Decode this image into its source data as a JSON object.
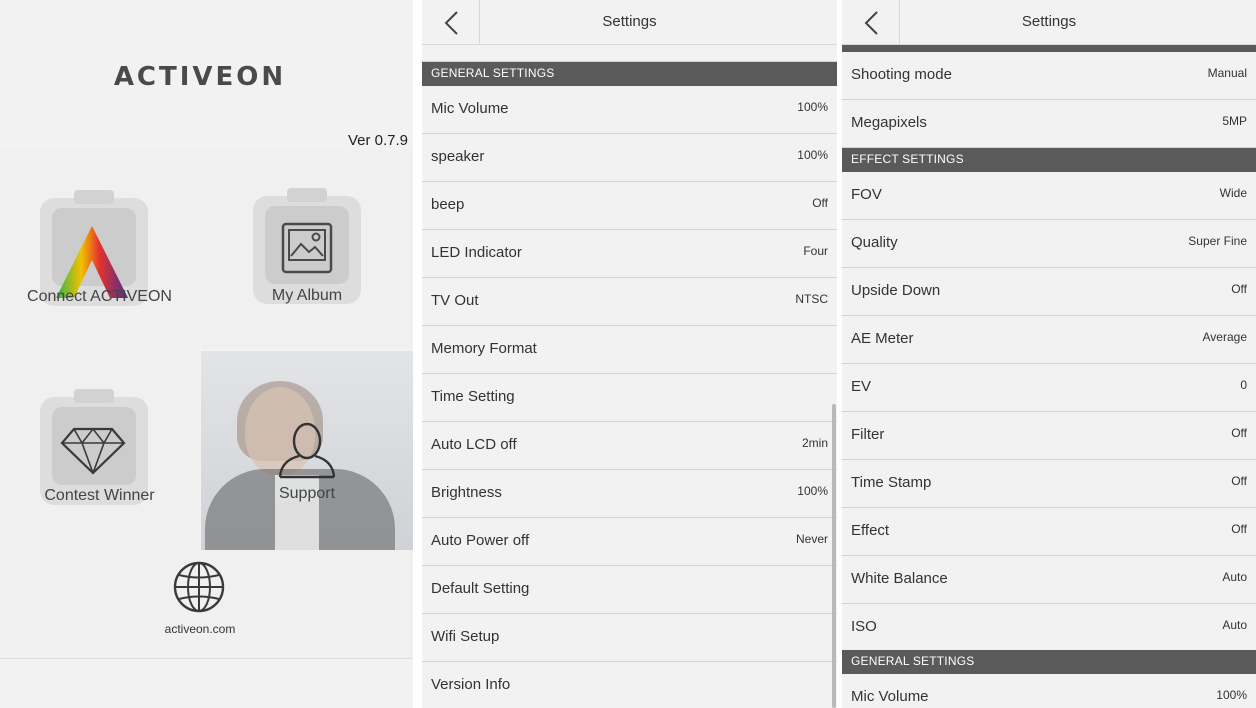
{
  "home": {
    "logo": "ACTIVEON",
    "version": "Ver 0.7.9",
    "tiles": {
      "connect": "Connect ACTIVEON",
      "album": "My Album",
      "contest": "Contest Winner",
      "support": "Support"
    },
    "website": "activeon.com"
  },
  "settings_general": {
    "title": "Settings",
    "section": "GENERAL SETTINGS",
    "rows": [
      {
        "label": "Mic Volume",
        "value": "100%"
      },
      {
        "label": "speaker",
        "value": "100%"
      },
      {
        "label": "beep",
        "value": "Off"
      },
      {
        "label": "LED Indicator",
        "value": "Four"
      },
      {
        "label": "TV Out",
        "value": "NTSC"
      },
      {
        "label": "Memory Format",
        "value": ""
      },
      {
        "label": "Time Setting",
        "value": ""
      },
      {
        "label": "Auto LCD off",
        "value": "2min"
      },
      {
        "label": "Brightness",
        "value": "100%"
      },
      {
        "label": "Auto Power off",
        "value": "Never"
      },
      {
        "label": "Default Setting",
        "value": ""
      },
      {
        "label": "Wifi Setup",
        "value": ""
      },
      {
        "label": "Version Info",
        "value": ""
      }
    ]
  },
  "settings_effect": {
    "title": "Settings",
    "top_rows": [
      {
        "label": "Shooting mode",
        "value": "Manual"
      },
      {
        "label": "Megapixels",
        "value": "5MP"
      }
    ],
    "effect_section": "EFFECT SETTINGS",
    "effect_rows": [
      {
        "label": "FOV",
        "value": "Wide"
      },
      {
        "label": "Quality",
        "value": "Super Fine"
      },
      {
        "label": "Upside Down",
        "value": "Off"
      },
      {
        "label": "AE Meter",
        "value": "Average"
      },
      {
        "label": "EV",
        "value": "0"
      },
      {
        "label": "Filter",
        "value": "Off"
      },
      {
        "label": "Time Stamp",
        "value": "Off"
      },
      {
        "label": "Effect",
        "value": "Off"
      },
      {
        "label": "White Balance",
        "value": "Auto"
      },
      {
        "label": "ISO",
        "value": "Auto"
      }
    ],
    "general_section": "GENERAL SETTINGS",
    "general_rows": [
      {
        "label": "Mic Volume",
        "value": "100%"
      }
    ]
  },
  "colors": {
    "section_bg": "#5a5a5a",
    "panel_bg": "#f2f2f2",
    "divider": "#d3d3d3"
  }
}
